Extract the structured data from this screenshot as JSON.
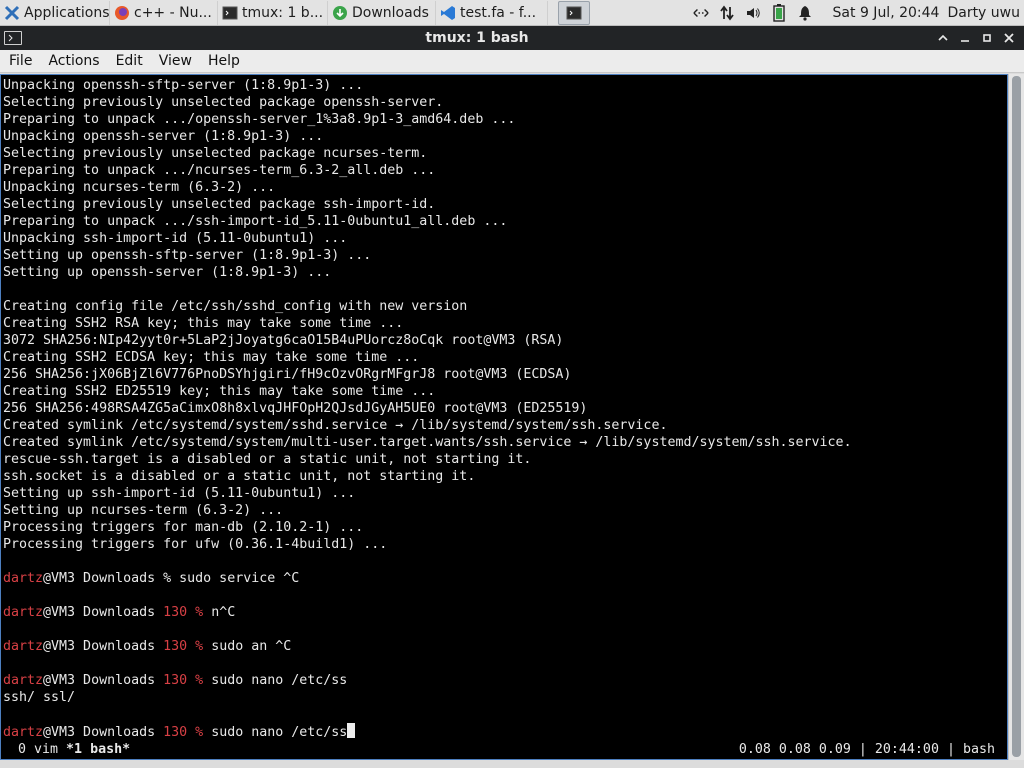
{
  "panel": {
    "tasks": [
      {
        "label": "Applications ☰",
        "icon": "xfce-logo-icon"
      },
      {
        "label": "c++ - Nu...",
        "icon": "firefox-icon"
      },
      {
        "label": "tmux: 1 b...",
        "icon": "terminal-icon"
      },
      {
        "label": "Downloads",
        "icon": "download-icon"
      },
      {
        "label": "test.fa - f...",
        "icon": "vscode-icon"
      },
      {
        "label": "",
        "icon": "terminal-icon"
      }
    ],
    "tray_icons": [
      "network-icon",
      "transfer-icon",
      "volume-icon",
      "battery-icon",
      "notification-bell-icon"
    ],
    "clock": "Sat  9 Jul, 20:44",
    "user": "Darty uwu"
  },
  "window": {
    "title": "tmux: 1 bash",
    "buttons": [
      "chevron-up-icon",
      "minimize-icon",
      "maximize-icon",
      "close-icon"
    ]
  },
  "menubar": [
    "File",
    "Actions",
    "Edit",
    "View",
    "Help"
  ],
  "terminal": {
    "output": [
      "Unpacking openssh-sftp-server (1:8.9p1-3) ...",
      "Selecting previously unselected package openssh-server.",
      "Preparing to unpack .../openssh-server_1%3a8.9p1-3_amd64.deb ...",
      "Unpacking openssh-server (1:8.9p1-3) ...",
      "Selecting previously unselected package ncurses-term.",
      "Preparing to unpack .../ncurses-term_6.3-2_all.deb ...",
      "Unpacking ncurses-term (6.3-2) ...",
      "Selecting previously unselected package ssh-import-id.",
      "Preparing to unpack .../ssh-import-id_5.11-0ubuntu1_all.deb ...",
      "Unpacking ssh-import-id (5.11-0ubuntu1) ...",
      "Setting up openssh-sftp-server (1:8.9p1-3) ...",
      "Setting up openssh-server (1:8.9p1-3) ...",
      "",
      "Creating config file /etc/ssh/sshd_config with new version",
      "Creating SSH2 RSA key; this may take some time ...",
      "3072 SHA256:NIp42yyt0r+5LaP2jJoyatg6caO15B4uPUorcz8oCqk root@VM3 (RSA)",
      "Creating SSH2 ECDSA key; this may take some time ...",
      "256 SHA256:jX06BjZl6V776PnoDSYhjgiri/fH9cOzvORgrMFgrJ8 root@VM3 (ECDSA)",
      "Creating SSH2 ED25519 key; this may take some time ...",
      "256 SHA256:498RSA4ZG5aCimxO8h8xlvqJHFOpH2QJsdJGyAH5UE0 root@VM3 (ED25519)",
      "Created symlink /etc/systemd/system/sshd.service → /lib/systemd/system/ssh.service.",
      "Created symlink /etc/systemd/system/multi-user.target.wants/ssh.service → /lib/systemd/system/ssh.service.",
      "rescue-ssh.target is a disabled or a static unit, not starting it.",
      "ssh.socket is a disabled or a static unit, not starting it.",
      "Setting up ssh-import-id (5.11-0ubuntu1) ...",
      "Setting up ncurses-term (6.3-2) ...",
      "Processing triggers for man-db (2.10.2-1) ...",
      "Processing triggers for ufw (0.36.1-4build1) ...",
      ""
    ],
    "prompt": {
      "user": "dartz",
      "host": "@VM3 Downloads",
      "sign": "%"
    },
    "commands": [
      {
        "code": "",
        "command": "sudo service ^C",
        "after": ""
      },
      {
        "code": "130",
        "command": "n^C",
        "after": ""
      },
      {
        "code": "130",
        "command": "sudo an ^C",
        "after": ""
      },
      {
        "code": "130",
        "command": "sudo nano /etc/ss",
        "after": "ssh/ ssl/"
      },
      {
        "code": "130",
        "command": "sudo nano /etc/ss",
        "after": null
      }
    ],
    "status": {
      "left_prefix": " 0 vim ",
      "active_window": "*1 bash*",
      "right": "0.08 0.08 0.09 | 20:44:00 | bash"
    }
  },
  "colors": {
    "prompt_user": "#d84045",
    "exit_code": "#d84045",
    "terminal_bg": "#000000",
    "terminal_fg": "#e9e9e9",
    "titlebar_bg": "#222426"
  }
}
